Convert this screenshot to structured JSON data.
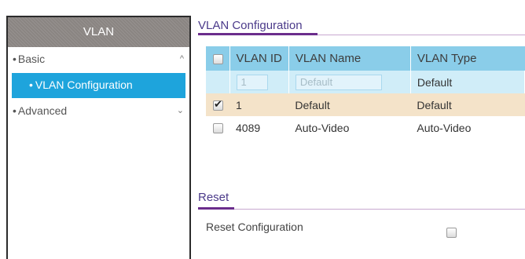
{
  "sidebar": {
    "header": "VLAN",
    "basic": {
      "label": "Basic",
      "bullet": "•",
      "chevron": "^"
    },
    "vlan_configuration": {
      "label": "VLAN Configuration",
      "bullet": "•"
    },
    "advanced": {
      "label": "Advanced",
      "bullet": "•",
      "chevron": "⌄"
    }
  },
  "vlan_config_section": {
    "title": "VLAN Configuration",
    "columns": [
      "VLAN ID",
      "VLAN Name",
      "VLAN Type"
    ],
    "input_row": {
      "id_placeholder": "1",
      "name_placeholder": "Default",
      "type": "Default"
    },
    "rows": [
      {
        "checked": true,
        "id": "1",
        "name": "Default",
        "type": "Default"
      },
      {
        "checked": false,
        "id": "4089",
        "name": "Auto-Video",
        "type": "Auto-Video"
      }
    ]
  },
  "reset_section": {
    "title": "Reset",
    "label": "Reset Configuration",
    "checked": false
  },
  "colors": {
    "accent_blue": "#1ea4dc",
    "header_row": "#8acde9",
    "selected_row": "#f4e3c9",
    "section_title": "#4b3a8a",
    "section_underline": "#6b2d8c"
  }
}
